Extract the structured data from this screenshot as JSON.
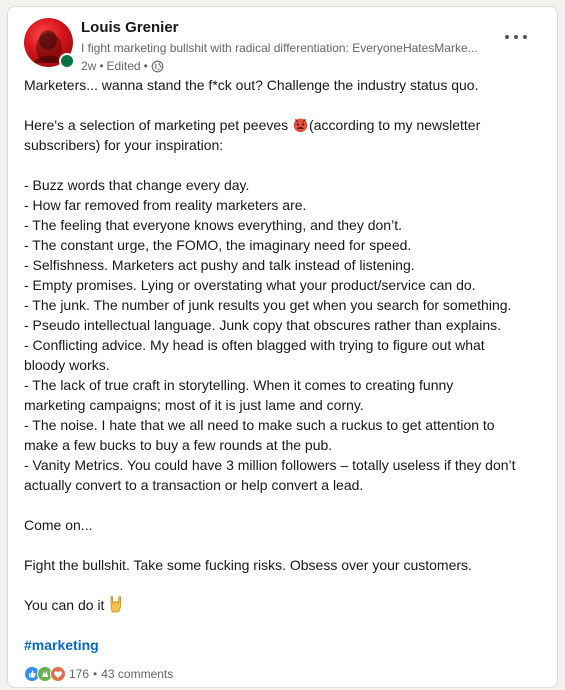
{
  "author": {
    "name": "Louis Grenier",
    "headline": "I fight marketing bullshit with radical differentiation: EveryoneHatesMarke...",
    "time": "2w",
    "edited": "Edited",
    "dot": "•"
  },
  "post": {
    "lines": [
      "Marketers... wanna stand the f*ck out? Challenge the industry status quo.",
      "",
      "Here's a selection of marketing pet peeves",
      "(according to my newsletter",
      "subscribers) for your inspiration:",
      "",
      "- Buzz words that change every day.",
      "- How far removed from reality marketers are.",
      "- The feeling that everyone knows everything, and they don’t.",
      "- The constant urge, the FOMO, the imaginary need for speed.",
      "- Selfishness. Marketers act pushy and talk instead of listening.",
      "- Empty promises. Lying or overstating what your product/service can do.",
      "- The junk. The number of junk results you get when you search for something.",
      "- Pseudo intellectual language. Junk copy that obscures rather than explains.",
      "- Conflicting advice. My head is often blagged with trying to figure out what",
      "bloody works.",
      "- The lack of true craft in storytelling. When it comes to creating funny",
      "marketing campaigns; most of it is just lame and corny.",
      "- The noise. I hate that we all need to make such a ruckus to get attention to",
      "make a few bucks to buy a few rounds at the pub.",
      "- Vanity Metrics. You could have 3 million followers – totally useless if they don’t",
      "actually convert to a transaction or help convert a lead.",
      "",
      "Come on...",
      "",
      "Fight the bullshit. Take some fucking risks. Obsess over your customers.",
      "",
      "You can do it"
    ],
    "hashtag": "#marketing"
  },
  "social": {
    "reaction_count": "176",
    "dot": "•",
    "comments": "43 comments"
  },
  "colors": {
    "link": "#0a66c2",
    "presence": "#057642",
    "like": "#378fe9",
    "celebrate": "#44712e",
    "love": "#df704d"
  },
  "icons": {
    "menu": "more-horizontal-icon",
    "visibility": "globe-icon",
    "emoji_peeve": "pouting-face-emoji",
    "emoji_rock": "sign-of-the-horns-emoji"
  }
}
